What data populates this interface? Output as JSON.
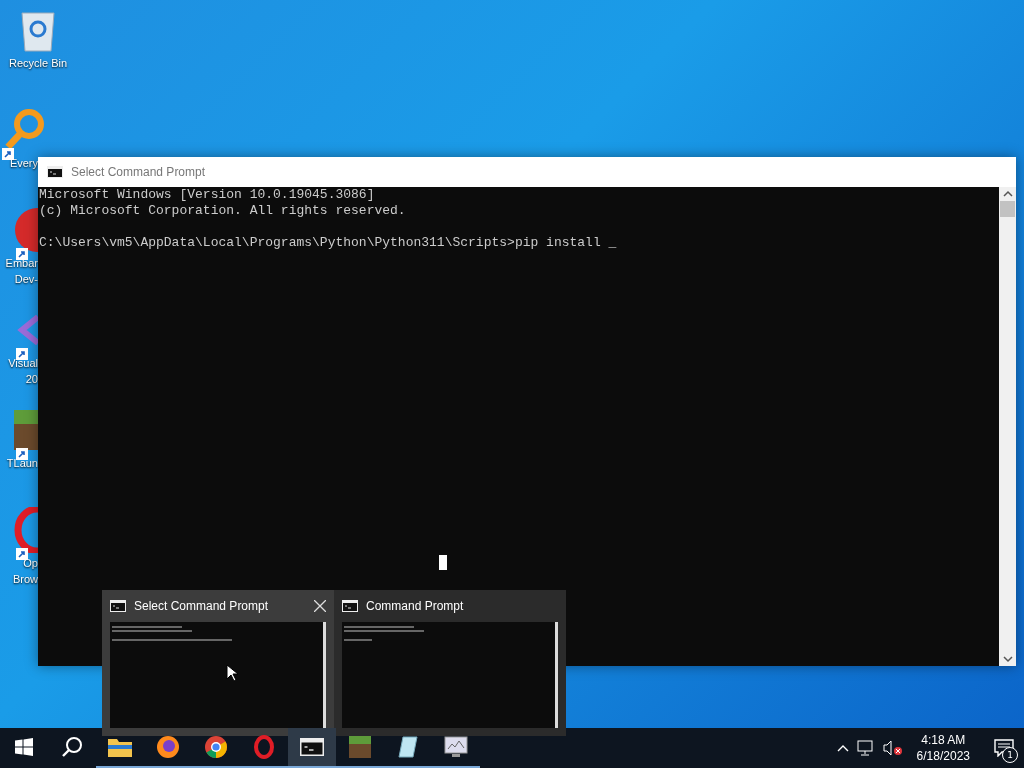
{
  "desktop_icons": [
    {
      "kind": "recycle",
      "lines": [
        "Recycle Bin"
      ],
      "shortcut": false
    },
    {
      "kind": "magnifier",
      "lines": [
        "Every"
      ],
      "shortcut": true
    },
    {
      "kind": "devcpp",
      "lines": [
        "Embar",
        "Dev-"
      ],
      "shortcut": true
    },
    {
      "kind": "vs",
      "lines": [
        "Visual",
        "20"
      ],
      "shortcut": true
    },
    {
      "kind": "grass",
      "lines": [
        "TLaun"
      ],
      "shortcut": true
    },
    {
      "kind": "opera",
      "lines": [
        "Op",
        "Brow"
      ],
      "shortcut": true
    }
  ],
  "window": {
    "title": "Select Command Prompt",
    "banner": [
      "Microsoft Windows [Version 10.0.19045.3086]",
      "(c) Microsoft Corporation. All rights reserved."
    ],
    "prompt": "C:\\Users\\vm5\\AppData\\Local\\Programs\\Python\\Python311\\Scripts>pip install _"
  },
  "thumbnails": [
    {
      "title": "Select Command Prompt",
      "selected": true
    },
    {
      "title": "Command Prompt",
      "selected": false
    }
  ],
  "taskbar": {
    "apps": [
      {
        "kind": "folder",
        "running": true,
        "selected": false
      },
      {
        "kind": "firefox",
        "running": true,
        "selected": false
      },
      {
        "kind": "chrome",
        "running": true,
        "selected": false
      },
      {
        "kind": "opera",
        "running": true,
        "selected": false
      },
      {
        "kind": "terminal",
        "running": true,
        "selected": true
      },
      {
        "kind": "grass",
        "running": true,
        "selected": false
      },
      {
        "kind": "notepad",
        "running": true,
        "selected": false
      },
      {
        "kind": "monitor",
        "running": true,
        "selected": false
      }
    ],
    "time": "4:18 AM",
    "date": "6/18/2023",
    "notifications": "1"
  }
}
